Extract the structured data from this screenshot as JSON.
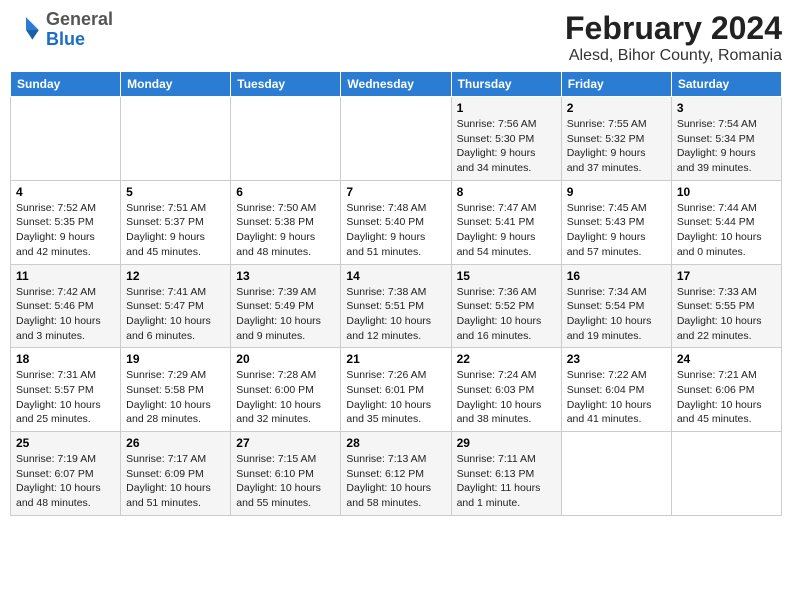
{
  "header": {
    "logo_general": "General",
    "logo_blue": "Blue",
    "title": "February 2024",
    "subtitle": "Alesd, Bihor County, Romania"
  },
  "calendar": {
    "days_of_week": [
      "Sunday",
      "Monday",
      "Tuesday",
      "Wednesday",
      "Thursday",
      "Friday",
      "Saturday"
    ],
    "weeks": [
      [
        {
          "day": "",
          "info": ""
        },
        {
          "day": "",
          "info": ""
        },
        {
          "day": "",
          "info": ""
        },
        {
          "day": "",
          "info": ""
        },
        {
          "day": "1",
          "info": "Sunrise: 7:56 AM\nSunset: 5:30 PM\nDaylight: 9 hours\nand 34 minutes."
        },
        {
          "day": "2",
          "info": "Sunrise: 7:55 AM\nSunset: 5:32 PM\nDaylight: 9 hours\nand 37 minutes."
        },
        {
          "day": "3",
          "info": "Sunrise: 7:54 AM\nSunset: 5:34 PM\nDaylight: 9 hours\nand 39 minutes."
        }
      ],
      [
        {
          "day": "4",
          "info": "Sunrise: 7:52 AM\nSunset: 5:35 PM\nDaylight: 9 hours\nand 42 minutes."
        },
        {
          "day": "5",
          "info": "Sunrise: 7:51 AM\nSunset: 5:37 PM\nDaylight: 9 hours\nand 45 minutes."
        },
        {
          "day": "6",
          "info": "Sunrise: 7:50 AM\nSunset: 5:38 PM\nDaylight: 9 hours\nand 48 minutes."
        },
        {
          "day": "7",
          "info": "Sunrise: 7:48 AM\nSunset: 5:40 PM\nDaylight: 9 hours\nand 51 minutes."
        },
        {
          "day": "8",
          "info": "Sunrise: 7:47 AM\nSunset: 5:41 PM\nDaylight: 9 hours\nand 54 minutes."
        },
        {
          "day": "9",
          "info": "Sunrise: 7:45 AM\nSunset: 5:43 PM\nDaylight: 9 hours\nand 57 minutes."
        },
        {
          "day": "10",
          "info": "Sunrise: 7:44 AM\nSunset: 5:44 PM\nDaylight: 10 hours\nand 0 minutes."
        }
      ],
      [
        {
          "day": "11",
          "info": "Sunrise: 7:42 AM\nSunset: 5:46 PM\nDaylight: 10 hours\nand 3 minutes."
        },
        {
          "day": "12",
          "info": "Sunrise: 7:41 AM\nSunset: 5:47 PM\nDaylight: 10 hours\nand 6 minutes."
        },
        {
          "day": "13",
          "info": "Sunrise: 7:39 AM\nSunset: 5:49 PM\nDaylight: 10 hours\nand 9 minutes."
        },
        {
          "day": "14",
          "info": "Sunrise: 7:38 AM\nSunset: 5:51 PM\nDaylight: 10 hours\nand 12 minutes."
        },
        {
          "day": "15",
          "info": "Sunrise: 7:36 AM\nSunset: 5:52 PM\nDaylight: 10 hours\nand 16 minutes."
        },
        {
          "day": "16",
          "info": "Sunrise: 7:34 AM\nSunset: 5:54 PM\nDaylight: 10 hours\nand 19 minutes."
        },
        {
          "day": "17",
          "info": "Sunrise: 7:33 AM\nSunset: 5:55 PM\nDaylight: 10 hours\nand 22 minutes."
        }
      ],
      [
        {
          "day": "18",
          "info": "Sunrise: 7:31 AM\nSunset: 5:57 PM\nDaylight: 10 hours\nand 25 minutes."
        },
        {
          "day": "19",
          "info": "Sunrise: 7:29 AM\nSunset: 5:58 PM\nDaylight: 10 hours\nand 28 minutes."
        },
        {
          "day": "20",
          "info": "Sunrise: 7:28 AM\nSunset: 6:00 PM\nDaylight: 10 hours\nand 32 minutes."
        },
        {
          "day": "21",
          "info": "Sunrise: 7:26 AM\nSunset: 6:01 PM\nDaylight: 10 hours\nand 35 minutes."
        },
        {
          "day": "22",
          "info": "Sunrise: 7:24 AM\nSunset: 6:03 PM\nDaylight: 10 hours\nand 38 minutes."
        },
        {
          "day": "23",
          "info": "Sunrise: 7:22 AM\nSunset: 6:04 PM\nDaylight: 10 hours\nand 41 minutes."
        },
        {
          "day": "24",
          "info": "Sunrise: 7:21 AM\nSunset: 6:06 PM\nDaylight: 10 hours\nand 45 minutes."
        }
      ],
      [
        {
          "day": "25",
          "info": "Sunrise: 7:19 AM\nSunset: 6:07 PM\nDaylight: 10 hours\nand 48 minutes."
        },
        {
          "day": "26",
          "info": "Sunrise: 7:17 AM\nSunset: 6:09 PM\nDaylight: 10 hours\nand 51 minutes."
        },
        {
          "day": "27",
          "info": "Sunrise: 7:15 AM\nSunset: 6:10 PM\nDaylight: 10 hours\nand 55 minutes."
        },
        {
          "day": "28",
          "info": "Sunrise: 7:13 AM\nSunset: 6:12 PM\nDaylight: 10 hours\nand 58 minutes."
        },
        {
          "day": "29",
          "info": "Sunrise: 7:11 AM\nSunset: 6:13 PM\nDaylight: 11 hours\nand 1 minute."
        },
        {
          "day": "",
          "info": ""
        },
        {
          "day": "",
          "info": ""
        }
      ]
    ]
  }
}
